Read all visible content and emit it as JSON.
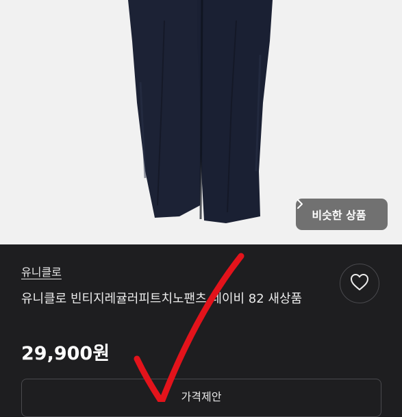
{
  "product": {
    "brand": "유니클로",
    "title": "유니클로 빈티지레귤러피트치노팬츠 네이비 82 새상품",
    "price": "29,900원"
  },
  "buttons": {
    "similar_label": "비슷한 상품",
    "offer_label": "가격제안"
  },
  "icons": {
    "similar_chevron": "chevron-right-icon",
    "like": "heart-icon"
  },
  "colors": {
    "background": "#1e1e20",
    "photo_background": "#f1f1f1",
    "pants": "#1c2235",
    "annotation": "#e3131b"
  }
}
